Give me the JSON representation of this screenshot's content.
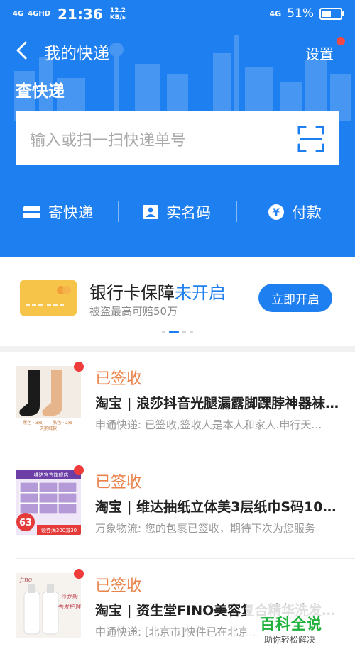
{
  "status_bar": {
    "signal_1": "4G",
    "signal_2": "4GHD",
    "time": "21:36",
    "speed_value": "12.2",
    "speed_unit": "KB/s",
    "net": "4G",
    "battery": "51%",
    "battery_level": 0.51
  },
  "header": {
    "title": "我的快递",
    "settings_label": "设置",
    "query_title": "查快递"
  },
  "search": {
    "placeholder": "输入或扫一扫快递单号"
  },
  "actions": [
    {
      "label": "寄快递",
      "icon": "package-box-icon"
    },
    {
      "label": "实名码",
      "icon": "id-card-icon"
    },
    {
      "label": "付款",
      "icon": "yen-coin-icon"
    }
  ],
  "banner": {
    "title_main": "银行卡保障",
    "title_accent": "未开启",
    "subtitle": "被盗最高可赔50万",
    "button": "立即开启",
    "carousel_count": 4,
    "carousel_active": 1
  },
  "parcels": [
    {
      "status": "已签收",
      "name": "淘宝 | 浪莎抖音光腿漏露脚踝脖神器袜…",
      "detail": "申通快递: 已签收,签收人是本人和家人.申行天…",
      "thumb_labels": [
        "黑色 · 3双",
        "肤色 · 2双",
        "天鹅绒款"
      ]
    },
    {
      "status": "已签收",
      "name": "淘宝 | 维达抽纸立体美3层纸巾S码108…",
      "detail": "万象物流: 您的包裹已签收，期待下次为您服务",
      "thumb_labels": [
        "维达官方旗舰店",
        "63",
        "领券满300减30"
      ]
    },
    {
      "status": "已签收",
      "name": "淘宝 | 资生堂FINO美容复合精华洗发水…",
      "detail": "中通快递: [北京市]快件已在北京…",
      "thumb_labels": [
        "fino",
        "沙龙般",
        "秀发护理"
      ]
    }
  ],
  "watermark": {
    "title": "百科全说",
    "subtitle": "助你轻松解决"
  },
  "colors": {
    "brand_blue": "#1e7ff0",
    "signed_orange": "#e9834a",
    "red_dot": "#f03b3b"
  }
}
